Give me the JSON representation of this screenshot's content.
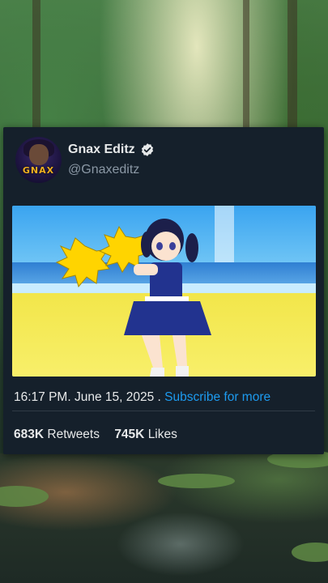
{
  "tweet": {
    "display_name": "Gnax Editz",
    "handle": "@Gnaxeditz",
    "avatar_text": "GNAX",
    "verified": true,
    "media_icon": "anime-cheerleader-image",
    "time": "16:17 PM",
    "date": "June 15, 2025",
    "link_text": "Subscribe for more",
    "retweets_count": "683K",
    "retweets_label": "Retweets",
    "likes_count": "745K",
    "likes_label": "Likes"
  },
  "colors": {
    "card_bg": "#15202b",
    "link": "#1d9bf0",
    "secondary_text": "#8b98a5",
    "primary_text": "#e7e9ea"
  }
}
